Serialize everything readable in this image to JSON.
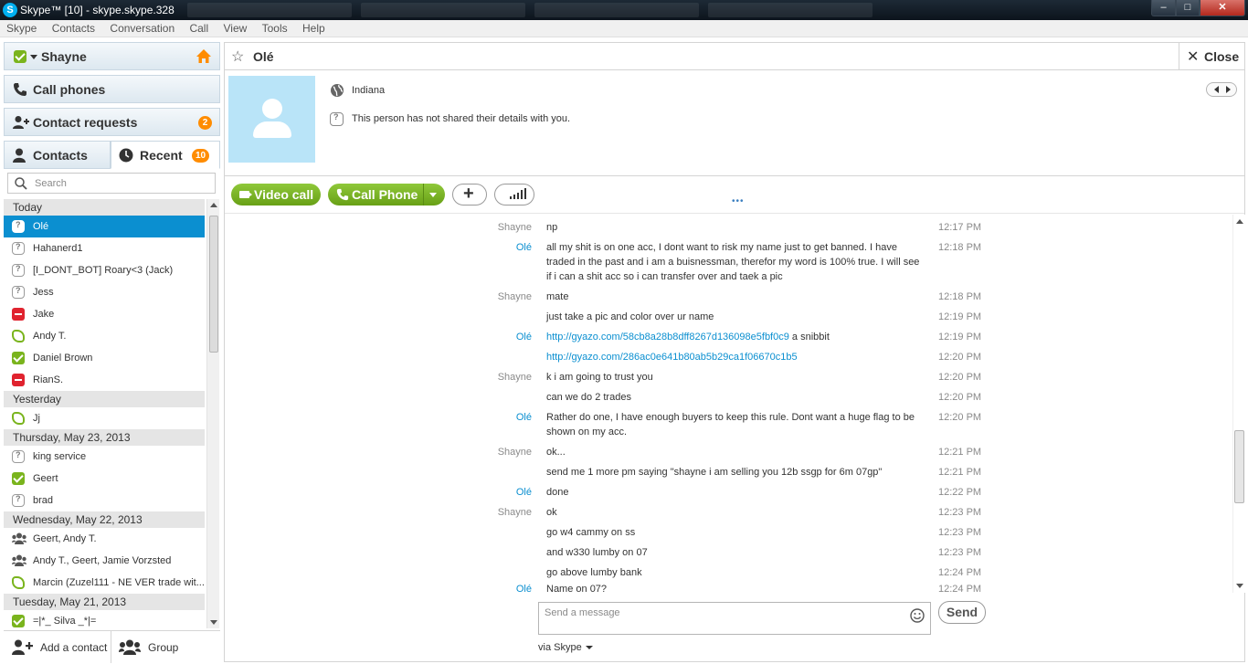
{
  "window": {
    "title": "Skype™ [10] - skype.skype.328",
    "app_icon_letter": "S"
  },
  "menu": [
    "Skype",
    "Contacts",
    "Conversation",
    "Call",
    "View",
    "Tools",
    "Help"
  ],
  "sidebar": {
    "profile_name": "Shayne",
    "call_phones_label": "Call phones",
    "contact_requests_label": "Contact requests",
    "contact_requests_count": "2",
    "tab_contacts_label": "Contacts",
    "tab_recent_label": "Recent",
    "recent_count": "10",
    "search_placeholder": "Search",
    "groups": [
      {
        "header": "Today",
        "items": [
          {
            "name": "Olé",
            "status": "unknown",
            "selected": true
          },
          {
            "name": "Hahanerd1",
            "status": "unknown"
          },
          {
            "name": "[I_DONT_BOT] Roary<3 (Jack)",
            "status": "unknown"
          },
          {
            "name": "Jess",
            "status": "unknown"
          },
          {
            "name": "Jake",
            "status": "busy"
          },
          {
            "name": "Andy T.",
            "status": "offline"
          },
          {
            "name": "Daniel Brown",
            "status": "online"
          },
          {
            "name": "RianS.",
            "status": "busy"
          }
        ]
      },
      {
        "header": "Yesterday",
        "items": [
          {
            "name": "Jj",
            "status": "offline"
          }
        ]
      },
      {
        "header": "Thursday, May 23, 2013",
        "items": [
          {
            "name": "king service",
            "status": "unknown"
          },
          {
            "name": "Geert",
            "status": "online"
          },
          {
            "name": "brad",
            "status": "unknown"
          }
        ]
      },
      {
        "header": "Wednesday, May 22, 2013",
        "items": [
          {
            "name": "Geert, Andy T.",
            "status": "group"
          },
          {
            "name": "Andy T., Geert, Jamie Vorzsted",
            "status": "group"
          },
          {
            "name": "Marcin (Zuzel111 - NE VER trade wit...",
            "status": "offline"
          }
        ]
      },
      {
        "header": "Tuesday, May 21, 2013",
        "items": [
          {
            "name": "=|*_ Silva _*|=",
            "status": "online"
          }
        ]
      }
    ],
    "add_contact_label": "Add a contact",
    "group_label": "Group"
  },
  "conversation": {
    "contact_name": "Olé",
    "close_label": "Close",
    "location": "Indiana",
    "details_note": "This person has not shared their details with you.",
    "video_call_label": "Video call",
    "call_phone_label": "Call Phone",
    "plus_label": "+",
    "compose_placeholder": "Send a message",
    "send_label": "Send",
    "via_label": "via Skype",
    "messages": [
      {
        "who": "Shayne",
        "text": "np",
        "time": "12:17 PM"
      },
      {
        "who": "Olé",
        "text": "all my shit is on one acc, I dont want to risk my name just to get banned. I have traded in the past and i am a buisnessman, therefor my word is 100% true. I will see if i can a shit acc so i can transfer over and taek a pic",
        "time": "12:18 PM"
      },
      {
        "who": "Shayne",
        "text": "mate",
        "time": "12:18 PM"
      },
      {
        "who": "",
        "text": "just take a pic and color over ur name",
        "time": "12:19 PM"
      },
      {
        "who": "Olé",
        "link": "http://gyazo.com/58cb8a28b8dff8267d136098e5fbf0c9",
        "text": " a snibbit",
        "time": "12:19 PM"
      },
      {
        "who": "",
        "link": "http://gyazo.com/286ac0e641b80ab5b29ca1f06670c1b5",
        "text": "",
        "time": "12:20 PM"
      },
      {
        "who": "Shayne",
        "text": "k  i am going to trust you",
        "time": "12:20 PM"
      },
      {
        "who": "",
        "text": "can we do 2 trades",
        "time": "12:20 PM"
      },
      {
        "who": "Olé",
        "text": "Rather do one, I have enough buyers to keep this rule. Dont want a huge flag to be shown on my acc.",
        "time": "12:20 PM"
      },
      {
        "who": "Shayne",
        "text": "ok...",
        "time": "12:21 PM"
      },
      {
        "who": "",
        "text": "send me 1 more pm saying \"shayne i am selling you 12b ssgp for 6m 07gp\"",
        "time": "12:21 PM"
      },
      {
        "who": "Olé",
        "text": "done",
        "time": "12:22 PM"
      },
      {
        "who": "Shayne",
        "text": "ok",
        "time": "12:23 PM"
      },
      {
        "who": "",
        "text": "go w4 cammy on ss",
        "time": "12:23 PM"
      },
      {
        "who": "",
        "text": "and w330 lumby on 07",
        "time": "12:23 PM"
      },
      {
        "who": "",
        "text": "go above lumby bank",
        "time": "12:24 PM"
      },
      {
        "who": "Olé",
        "text": "Name on 07?",
        "time": "12:24 PM"
      }
    ]
  },
  "colors": {
    "skype_blue": "#00aff0",
    "selected_row": "#0b8fd0",
    "call_green": "#7ab41d",
    "badge_orange": "#ff8c00",
    "busy_red": "#e0232f"
  }
}
